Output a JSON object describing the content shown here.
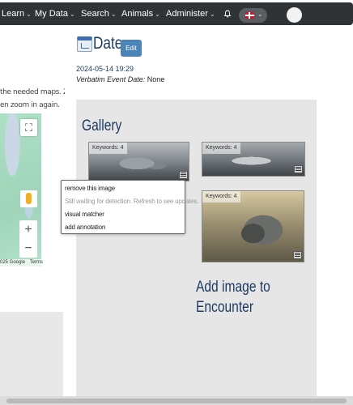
{
  "nav": {
    "items": [
      {
        "label": "Learn"
      },
      {
        "label": "My Data"
      },
      {
        "label": "Search"
      },
      {
        "label": "Animals"
      },
      {
        "label": "Administer"
      }
    ]
  },
  "help": {
    "line1": "the needed maps. Zoom",
    "line2": "en zoom in again."
  },
  "map": {
    "copyright": "025 Google",
    "terms": "Terms",
    "fullscreen_glyph": "⛶",
    "zoom_in": "+",
    "zoom_out": "−"
  },
  "date_section": {
    "title": "Date",
    "edit_label": "Edit",
    "date_value": "2024-05-14 19:29",
    "verbatim_label": "Verbatim Event Date:",
    "verbatim_value": "None"
  },
  "gallery": {
    "title": "Gallery",
    "thumbnails": [
      {
        "keywords": "Keywords: 4"
      },
      {
        "keywords": "Keywords: 4"
      },
      {
        "keywords": "Keywords: 4"
      }
    ],
    "context_menu": [
      {
        "label": "remove this image"
      },
      {
        "label": "Still waiting for detection. Refresh to see updates."
      },
      {
        "label": "visual matcher"
      },
      {
        "label": "add annotation"
      }
    ],
    "add_image_label": "Add image to Encounter"
  }
}
